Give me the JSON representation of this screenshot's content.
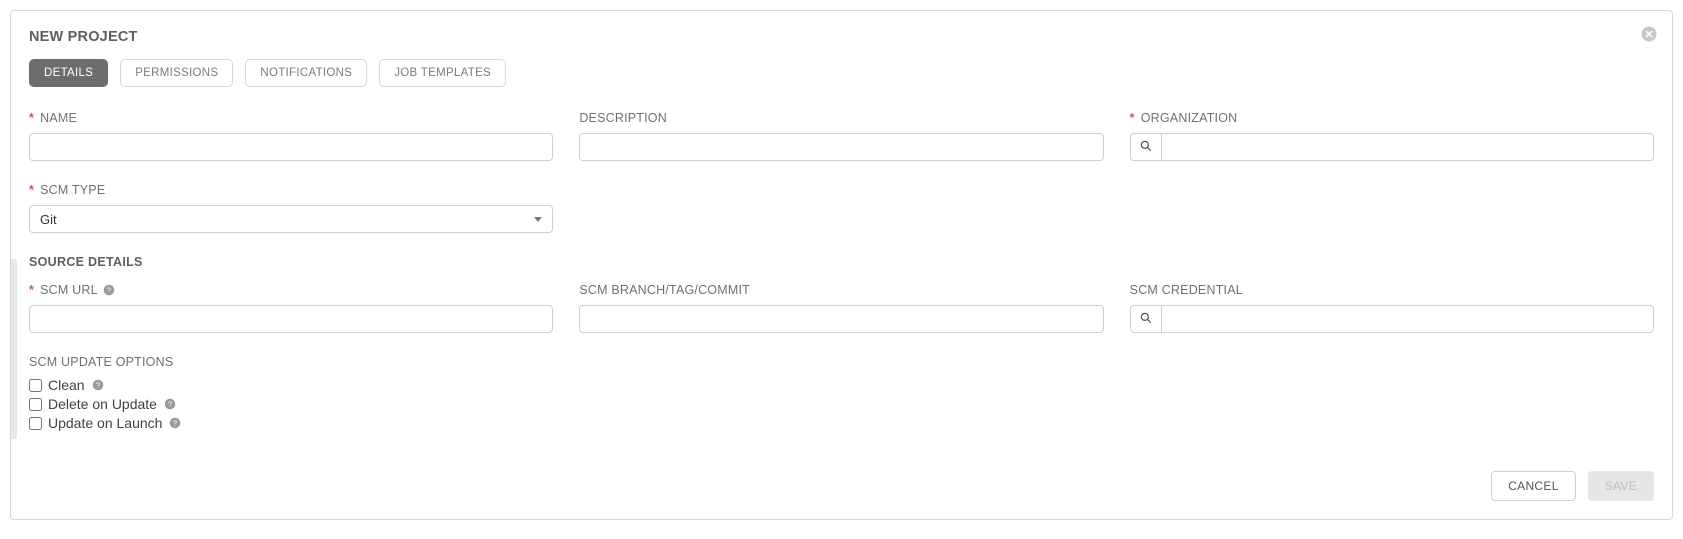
{
  "title": "NEW PROJECT",
  "tabs": {
    "details": "DETAILS",
    "permissions": "PERMISSIONS",
    "notifications": "NOTIFICATIONS",
    "job_templates": "JOB TEMPLATES"
  },
  "labels": {
    "name": "NAME",
    "description": "DESCRIPTION",
    "organization": "ORGANIZATION",
    "scm_type": "SCM TYPE",
    "source_details": "SOURCE DETAILS",
    "scm_url": "SCM URL",
    "scm_branch": "SCM BRANCH/TAG/COMMIT",
    "scm_credential": "SCM CREDENTIAL",
    "scm_update_options": "SCM UPDATE OPTIONS"
  },
  "values": {
    "name": "",
    "description": "",
    "organization": "",
    "scm_type": "Git",
    "scm_url": "",
    "scm_branch": "",
    "scm_credential": ""
  },
  "options": {
    "clean": "Clean",
    "delete_on_update": "Delete on Update",
    "update_on_launch": "Update on Launch"
  },
  "buttons": {
    "cancel": "CANCEL",
    "save": "SAVE"
  }
}
